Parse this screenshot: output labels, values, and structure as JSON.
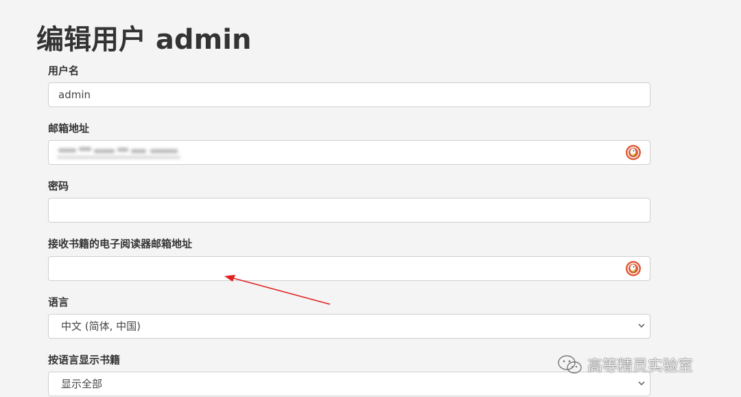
{
  "page": {
    "title": "编辑用户 admin"
  },
  "form": {
    "username": {
      "label": "用户名",
      "value": "admin"
    },
    "email": {
      "label": "邮箱地址",
      "value_obscured": true
    },
    "password": {
      "label": "密码",
      "value": ""
    },
    "kindle_email": {
      "label": "接收书籍的电子阅读器邮箱地址",
      "value": ""
    },
    "language": {
      "label": "语言",
      "selected": "中文 (简体, 中国)"
    },
    "books_language": {
      "label": "按语言显示书籍",
      "selected": "显示全部"
    }
  },
  "icons": {
    "autofill": "duckduckgo-icon",
    "dropdown": "chevron-down-icon",
    "watermark": "wechat-icon"
  },
  "annotation": {
    "color": "#e02020"
  },
  "watermark": {
    "text": "高等精灵实验室"
  }
}
